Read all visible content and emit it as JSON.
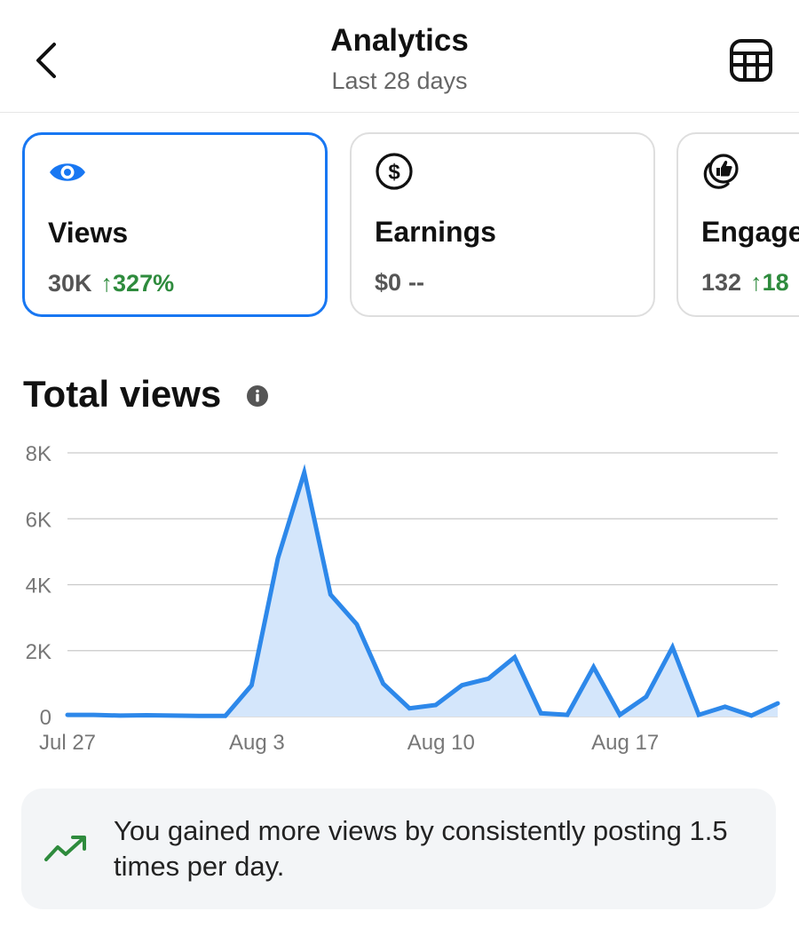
{
  "header": {
    "title": "Analytics",
    "subtitle": "Last 28 days",
    "back_icon": "chevron-left-icon",
    "table_icon": "table-icon"
  },
  "cards": [
    {
      "icon": "eye-icon",
      "label": "Views",
      "value": "30K",
      "change": "↑327%",
      "selected": true
    },
    {
      "icon": "dollar-circle-icon",
      "label": "Earnings",
      "value": "$0",
      "change": "--",
      "selected": false
    },
    {
      "icon": "engagement-thumbs-up-icon",
      "label": "Engage",
      "value": "132",
      "change": "↑18",
      "selected": false
    }
  ],
  "section": {
    "title": "Total views",
    "info_icon": "info-icon"
  },
  "chart_data": {
    "type": "area",
    "x": [
      "Jul 27",
      "Jul 28",
      "Jul 29",
      "Jul 30",
      "Jul 31",
      "Aug 1",
      "Aug 2",
      "Aug 3",
      "Aug 4",
      "Aug 5",
      "Aug 6",
      "Aug 7",
      "Aug 8",
      "Aug 9",
      "Aug 10",
      "Aug 11",
      "Aug 12",
      "Aug 13",
      "Aug 14",
      "Aug 15",
      "Aug 16",
      "Aug 17",
      "Aug 18",
      "Aug 19",
      "Aug 20",
      "Aug 21",
      "Aug 22",
      "Aug 23"
    ],
    "series": [
      {
        "values": [
          50,
          50,
          30,
          40,
          30,
          20,
          20,
          950,
          4800,
          7400,
          3700,
          2800,
          1000,
          250,
          350,
          950,
          1150,
          1800,
          100,
          50,
          1500,
          50,
          600,
          2100,
          50,
          300,
          30,
          400
        ]
      }
    ],
    "x_tick_labels": [
      "Jul 27",
      "Aug 3",
      "Aug 10",
      "Aug 17"
    ],
    "y_ticks": [
      0,
      2000,
      4000,
      6000,
      8000
    ],
    "y_tick_labels": [
      "0",
      "2K",
      "4K",
      "6K",
      "8K"
    ],
    "ylim": [
      0,
      8000
    ],
    "grid": true,
    "colors": {
      "line": "#2d88ea",
      "fill": "#d4e6fb",
      "grid": "#c9c9c9",
      "tick": "#777777"
    }
  },
  "insight": {
    "icon": "trending-up-icon",
    "text": "You gained more views by consistently posting 1.5 times per day."
  }
}
